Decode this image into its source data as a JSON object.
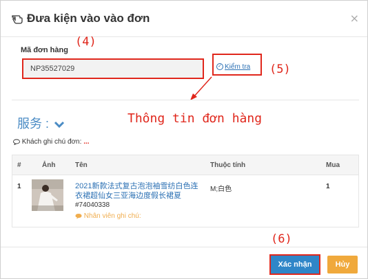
{
  "dialog": {
    "title": "Đưa kiện vào vào đơn",
    "close_symbol": "×"
  },
  "annotations": {
    "step4": "(4)",
    "step5": "(5)",
    "step6": "(6)",
    "order_info": "Thông tin đơn hàng"
  },
  "form": {
    "order_code_label": "Mã đơn hàng",
    "order_code_value": "NP35527029",
    "check_label": "Kiểm tra",
    "check_icon_symbol": "✓"
  },
  "service": {
    "label": "服务 :"
  },
  "customer_note": {
    "label": "Khách ghi chú đơn:",
    "value": "..."
  },
  "table": {
    "headers": [
      "#",
      "Ảnh",
      "Tên",
      "Thuộc tính",
      "Mua"
    ],
    "rows": [
      {
        "index": "1",
        "name": "2021新款法式复古泡泡袖雪纺白色连衣裙超仙女三亚海边度假长裙夏",
        "sku": "#74040338",
        "attribute": "M;白色",
        "qty": "1",
        "staff_note": "Nhân viên ghi chú:"
      }
    ]
  },
  "buttons": {
    "confirm": "Xác nhận",
    "cancel": "Hủy"
  },
  "colors": {
    "annotation_red": "#e0261b",
    "link_blue": "#2a6fb3",
    "confirm_blue": "#2f86c8",
    "cancel_orange": "#f0a93c"
  }
}
